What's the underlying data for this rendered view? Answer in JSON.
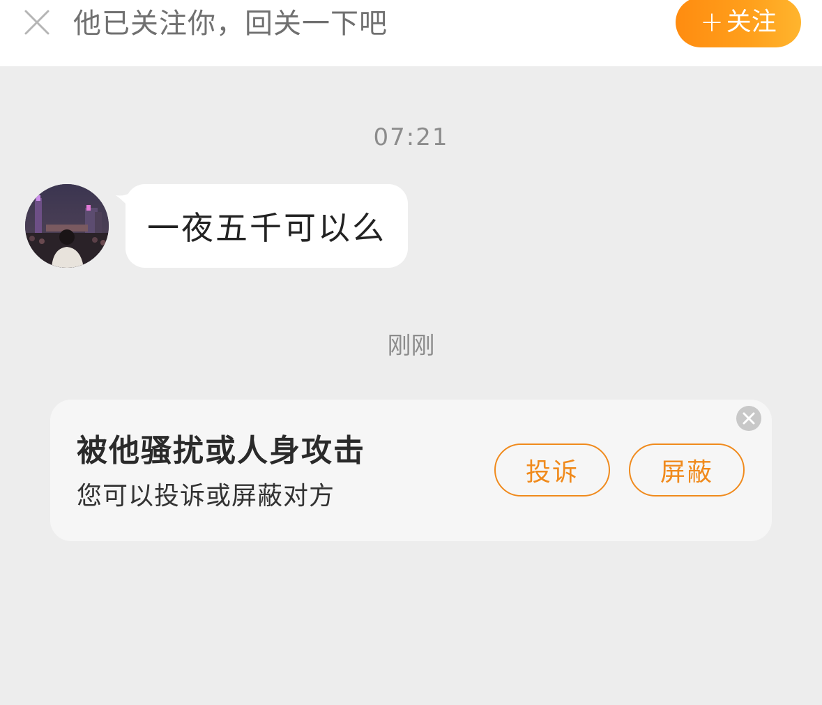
{
  "top_bar": {
    "close_icon": "close-icon",
    "prompt_text": "他已关注你，回关一下吧",
    "follow_button": {
      "plus": "+",
      "label": "关注"
    },
    "colors": {
      "follow_gradient_start": "#ff8c10",
      "follow_gradient_end": "#ffb52e"
    }
  },
  "chat": {
    "timestamps": [
      "07:21",
      "刚刚"
    ],
    "messages": [
      {
        "sender": "other",
        "avatar": "avatar-photo",
        "text": "一夜五千可以么"
      }
    ]
  },
  "report_card": {
    "title": "被他骚扰或人身攻击",
    "subtitle": "您可以投诉或屏蔽对方",
    "complain_label": "投诉",
    "block_label": "屏蔽",
    "close_icon": "close-circle-icon",
    "accent_color": "#f08a1c"
  }
}
